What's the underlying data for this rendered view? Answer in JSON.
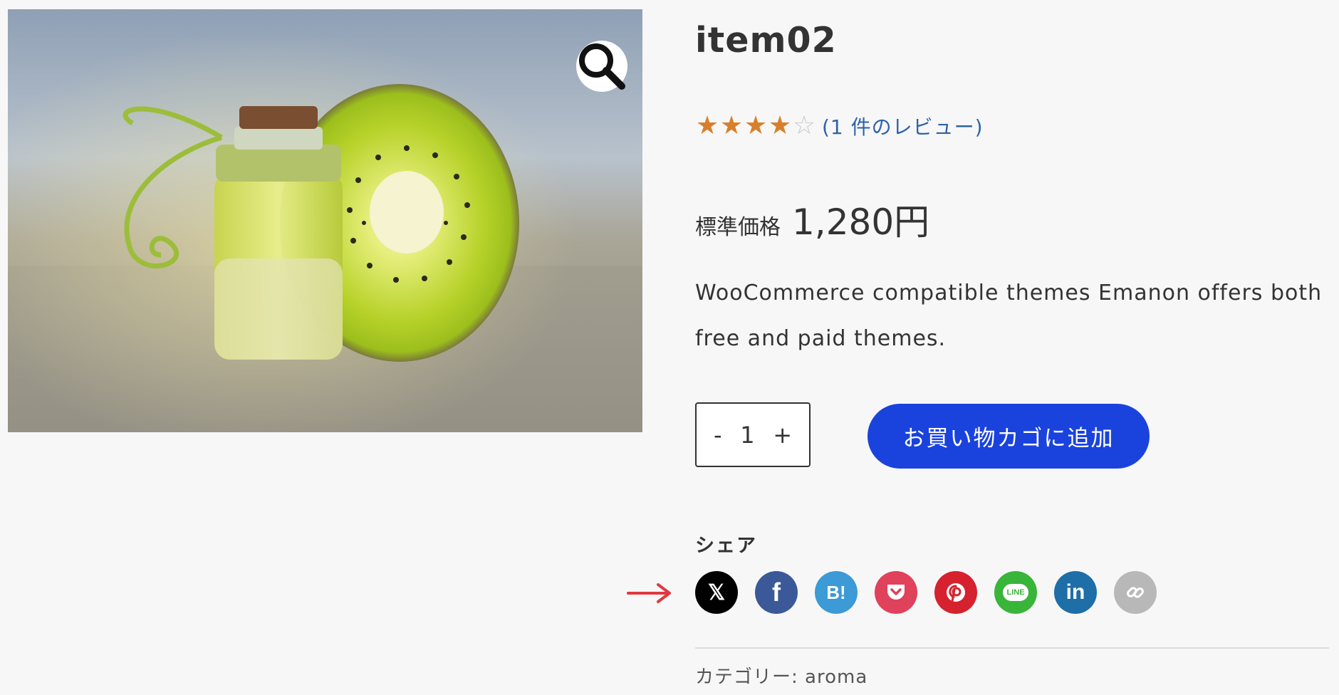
{
  "product": {
    "title": "item02",
    "rating_value": 4,
    "rating_max": 5,
    "review_link": "(1 件のレビュー)",
    "price_label": "標準価格",
    "price_amount": "1,280円",
    "description": "WooCommerce compatible themes Emanon offers both free and paid themes."
  },
  "cart": {
    "minus": "-",
    "quantity": "1",
    "plus": "+",
    "add_to_cart": "お買い物カゴに追加"
  },
  "share": {
    "label": "シェア",
    "buttons": [
      {
        "icon": "x-icon",
        "text": "𝕏",
        "color": "#000000"
      },
      {
        "icon": "facebook-icon",
        "text": "f",
        "color": "#3b5998"
      },
      {
        "icon": "hatena-bookmark-icon",
        "text": "B!",
        "color": "#3c9ad6"
      },
      {
        "icon": "pocket-icon",
        "text": "",
        "color": "#e0415b"
      },
      {
        "icon": "pinterest-icon",
        "text": "",
        "color": "#d6212e"
      },
      {
        "icon": "line-icon",
        "text": "LINE",
        "color": "#39b53a"
      },
      {
        "icon": "linkedin-icon",
        "text": "in",
        "color": "#1e6ea8"
      },
      {
        "icon": "link-icon",
        "text": "",
        "color": "#b8b8b8"
      }
    ]
  },
  "meta": {
    "category_label": "カテゴリー: ",
    "category_value": "aroma"
  },
  "colors": {
    "star": "#d97f2c",
    "review_link": "#2e63a6",
    "add_to_cart": "#1a43dd",
    "arrow": "#e0383f"
  }
}
